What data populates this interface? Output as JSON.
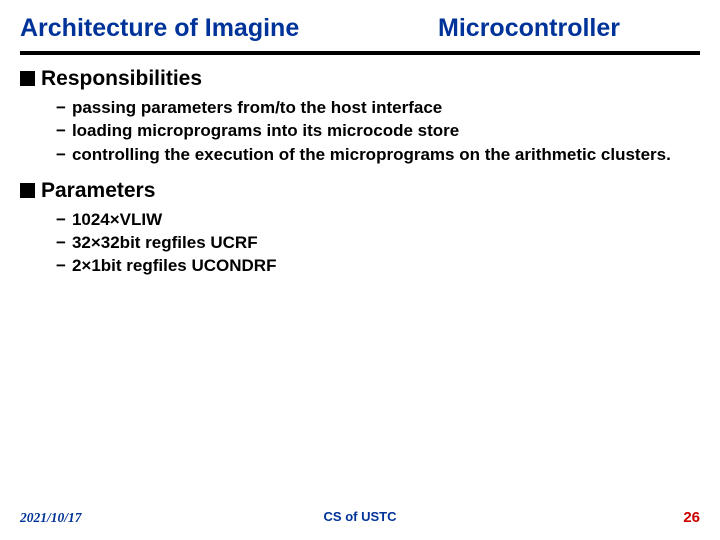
{
  "title_left": "Architecture of Imagine",
  "title_right": "Microcontroller",
  "sections": [
    {
      "heading": "Responsibilities",
      "items": [
        "passing parameters from/to the host interface",
        "loading microprograms into its microcode store",
        "controlling the execution of the microprograms on the arithmetic clusters."
      ]
    },
    {
      "heading": "Parameters",
      "items": [
        "1024×VLIW",
        "32×32bit regfiles UCRF",
        "2×1bit regfiles UCONDRF"
      ]
    }
  ],
  "footer": {
    "date": "2021/10/17",
    "center": "CS of USTC",
    "page": "26"
  }
}
